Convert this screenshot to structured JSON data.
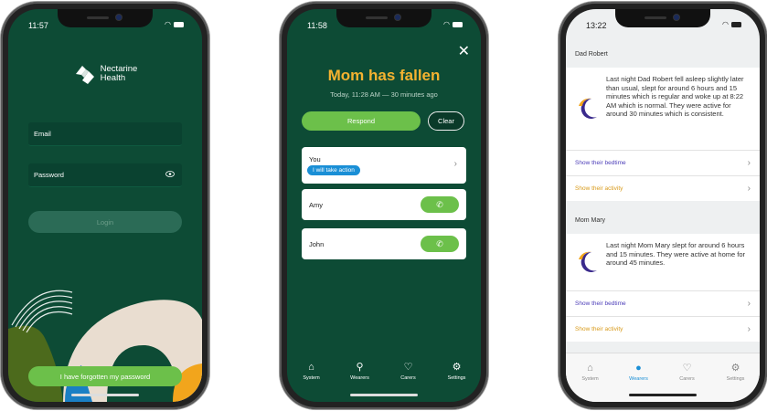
{
  "colors": {
    "brand_green": "#0d4b35",
    "accent_green": "#6cc04a",
    "alert_amber": "#f4b230",
    "link_purple": "#4b3cb8",
    "link_amber": "#d89a1a",
    "tag_blue": "#1a8fd6"
  },
  "login_screen": {
    "status_time": "11:57",
    "logo_line1": "Nectarine",
    "logo_line2": "Health",
    "email_placeholder": "Email",
    "password_placeholder": "Password",
    "login_label": "Login",
    "forgot_label": "I have forgotten my password"
  },
  "alert_screen": {
    "status_time": "11:58",
    "title": "Mom has fallen",
    "subtitle": "Today, 11:28 AM — 30 minutes ago",
    "respond_label": "Respond",
    "clear_label": "Clear",
    "responders": [
      {
        "name": "You",
        "tag": "I will take action"
      },
      {
        "name": "Amy"
      },
      {
        "name": "John"
      }
    ],
    "tabs": [
      {
        "label": "System",
        "icon": "home-icon"
      },
      {
        "label": "Wearers",
        "icon": "person-icon"
      },
      {
        "label": "Carers",
        "icon": "heart-icon"
      },
      {
        "label": "Settings",
        "icon": "sliders-icon"
      }
    ]
  },
  "sleep_screen": {
    "status_time": "13:22",
    "sections": [
      {
        "title": "Dad Robert",
        "summary": "Last night Dad Robert fell asleep slightly later than usual, slept for around 6 hours and 15 minutes which is regular and woke up at 8:22 AM which is normal. They were active for around 30 minutes which is consistent.",
        "bedtime_link": "Show their bedtime",
        "activity_link": "Show their activity"
      },
      {
        "title": "Mom Mary",
        "summary": "Last night Mom Mary slept for around 6 hours and 15 minutes. They were active at home for around 45 minutes.",
        "bedtime_link": "Show their bedtime",
        "activity_link": "Show their activity"
      }
    ],
    "tabs": [
      {
        "label": "System",
        "icon": "home-icon"
      },
      {
        "label": "Wearers",
        "icon": "person-icon"
      },
      {
        "label": "Carers",
        "icon": "heart-icon"
      },
      {
        "label": "Settings",
        "icon": "sliders-icon"
      }
    ],
    "active_tab": "Wearers"
  }
}
